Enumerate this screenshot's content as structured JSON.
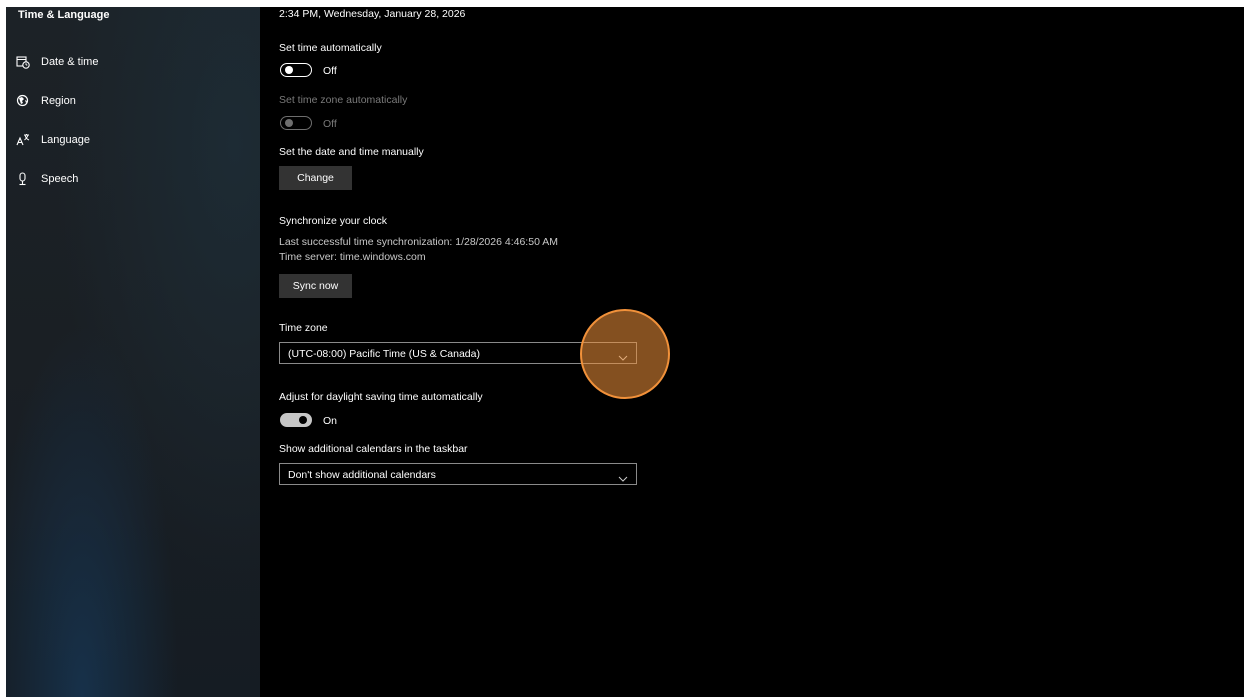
{
  "sidebar": {
    "title": "Time & Language",
    "items": [
      {
        "label": "Date & time",
        "icon": "date-time-icon"
      },
      {
        "label": "Region",
        "icon": "region-globe-icon"
      },
      {
        "label": "Language",
        "icon": "language-icon"
      },
      {
        "label": "Speech",
        "icon": "microphone-icon"
      }
    ]
  },
  "main": {
    "current_datetime": "2:34 PM, Wednesday, January 28, 2026",
    "set_time_auto": {
      "label": "Set time automatically",
      "state": "Off"
    },
    "set_timezone_auto": {
      "label": "Set time zone automatically",
      "state": "Off"
    },
    "manual": {
      "label": "Set the date and time manually",
      "button": "Change"
    },
    "sync": {
      "heading": "Synchronize your clock",
      "last_sync": "Last successful time synchronization: 1/28/2026 4:46:50 AM",
      "server": "Time server: time.windows.com",
      "button": "Sync now"
    },
    "timezone": {
      "label": "Time zone",
      "value": "(UTC-08:00) Pacific Time (US & Canada)"
    },
    "dst": {
      "label": "Adjust for daylight saving time automatically",
      "state": "On"
    },
    "calendars": {
      "label": "Show additional calendars in the taskbar",
      "value": "Don't show additional calendars"
    }
  },
  "colors": {
    "background": "#000000",
    "sidebar": "#1c2227",
    "button": "#333333",
    "highlight": "#f1913a"
  }
}
